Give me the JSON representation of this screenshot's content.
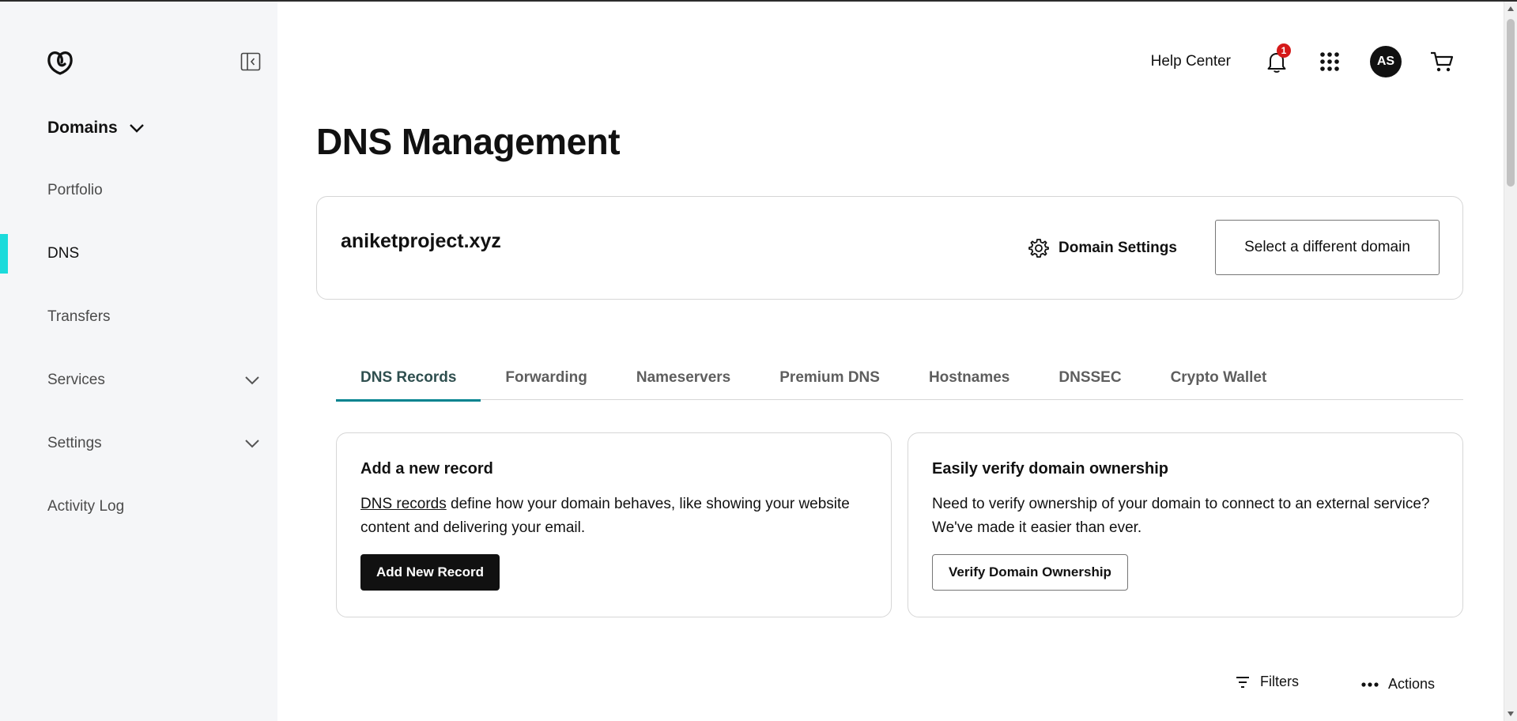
{
  "sidebar": {
    "section_title": "Domains",
    "items": [
      {
        "label": "Portfolio",
        "active": false,
        "expandable": false
      },
      {
        "label": "DNS",
        "active": true,
        "expandable": false
      },
      {
        "label": "Transfers",
        "active": false,
        "expandable": false
      },
      {
        "label": "Services",
        "active": false,
        "expandable": true
      },
      {
        "label": "Settings",
        "active": false,
        "expandable": true
      },
      {
        "label": "Activity Log",
        "active": false,
        "expandable": false
      }
    ],
    "active_color": "#1bdbdb"
  },
  "header": {
    "help_label": "Help Center",
    "notification_count": "1",
    "avatar_initials": "AS"
  },
  "page": {
    "title": "DNS Management"
  },
  "domain_card": {
    "domain": "aniketproject.xyz",
    "settings_label": "Domain Settings",
    "select_label": "Select a different domain"
  },
  "tabs": [
    {
      "label": "DNS Records",
      "active": true
    },
    {
      "label": "Forwarding",
      "active": false
    },
    {
      "label": "Nameservers",
      "active": false
    },
    {
      "label": "Premium DNS",
      "active": false
    },
    {
      "label": "Hostnames",
      "active": false
    },
    {
      "label": "DNSSEC",
      "active": false
    },
    {
      "label": "Crypto Wallet",
      "active": false
    }
  ],
  "add_record_card": {
    "title": "Add a new record",
    "link_text": "DNS records",
    "body_rest": " define how your domain behaves, like showing your website content and delivering your email.",
    "button_label": "Add New Record"
  },
  "verify_card": {
    "title": "Easily verify domain ownership",
    "body": "Need to verify ownership of your domain to connect to an external service? We've made it easier than ever.",
    "button_label": "Verify Domain Ownership"
  },
  "toolbar": {
    "filters_label": "Filters",
    "actions_label": "Actions"
  },
  "colors": {
    "accent_tab": "#00838f",
    "badge": "#d51a1a",
    "primary_button": "#111111"
  }
}
